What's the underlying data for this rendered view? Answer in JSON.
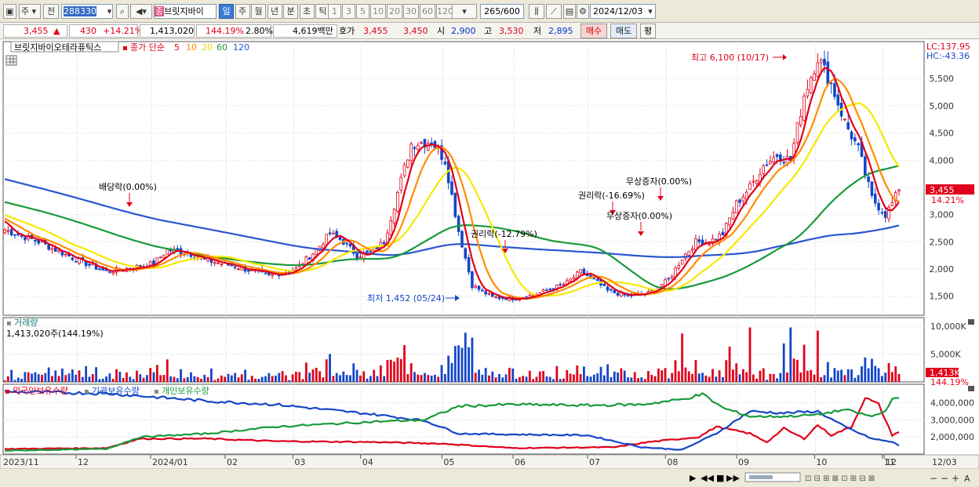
{
  "toolbar": {
    "market": "주",
    "prev": "전",
    "code": "288330",
    "badge": "종",
    "name": "브릿지바이",
    "periods": [
      "일",
      "주",
      "월",
      "년",
      "분",
      "초",
      "틱"
    ],
    "intervals": [
      "1",
      "3",
      "5",
      "10",
      "20",
      "30",
      "60",
      "120"
    ],
    "count": "265/600",
    "date": "2024/12/03"
  },
  "info": {
    "price": "3,455",
    "change": "430",
    "change_pct": "+14.21%",
    "volume": "1,413,020",
    "volume_ratio": "144.19%",
    "turnover": "2.80%",
    "amount": "4,619백만",
    "quote_label": "호가",
    "ask": "3,455",
    "bid": "3,450",
    "open_label": "시",
    "open": "2,900",
    "high_label": "고",
    "high": "3,530",
    "low_label": "저",
    "low": "2,895",
    "buy": "매수",
    "sell": "매도",
    "eval": "평"
  },
  "colors": {
    "up": "#e0001a",
    "down": "#1546c8",
    "ma5": "#e0001a",
    "ma10": "#ff8c00",
    "ma20": "#f7e800",
    "ma60": "#1a9a3c",
    "ma120": "#2a56d0"
  },
  "price_pane": {
    "stock_name": "브릿지바이오테라퓨틱스",
    "series_label": "종가 단순",
    "ma_labels": [
      "5",
      "10",
      "20",
      "60",
      "120"
    ],
    "lc": "LC:137.95",
    "hc": "HC:-43.36",
    "current_tag": "3,455",
    "current_pct": "14.21%",
    "annotations": {
      "dividend": "배당락(0.00%)",
      "rights1": "권리락(-12.79%)",
      "rights2": "권리락(-16.69%)",
      "bonus1": "무상증자(0.00%)",
      "bonus2": "무상증자(0.00%)",
      "max": "최고 6,100 (10/17)",
      "min": "최저 1,452 (05/24)"
    }
  },
  "volume_pane": {
    "title": "거래량",
    "value": "1,413,020주(144.19%)",
    "tag": "1,413K",
    "tag_pct": "144.19%"
  },
  "holdings_pane": {
    "legend": [
      "외국인보유수량",
      "기관보유수량",
      "개인보유수량"
    ]
  },
  "x_axis": [
    "2023/11",
    "12",
    "2024/01",
    "02",
    "03",
    "04",
    "05",
    "06",
    "07",
    "08",
    "09",
    "10",
    "11",
    "12",
    "12/03"
  ],
  "chart_data": [
    {
      "type": "line",
      "title": "브릿지바이오테라퓨틱스 종가 단순",
      "x": [
        "2023/11",
        "12",
        "2024/01",
        "02",
        "03",
        "04",
        "05",
        "06",
        "07",
        "08",
        "09",
        "10",
        "11",
        "12"
      ],
      "y_ticks": [
        1500,
        2000,
        2500,
        3000,
        3500,
        4000,
        4500,
        5000,
        5500
      ],
      "ylim": [
        1150,
        6180
      ],
      "series": [
        {
          "name": "5",
          "values": [
            2700,
            2000,
            2300,
            1800,
            2300,
            4300,
            1500,
            1950,
            1550,
            2600,
            4000,
            6000,
            3500,
            3450
          ]
        },
        {
          "name": "10",
          "values": [
            2700,
            2020,
            2250,
            1850,
            2200,
            4300,
            1550,
            1900,
            1600,
            2550,
            3900,
            5800,
            3700,
            3150
          ]
        },
        {
          "name": "20",
          "values": [
            2700,
            2050,
            2200,
            1900,
            2150,
            3500,
            1700,
            1750,
            1650,
            2400,
            3700,
            5000,
            4200,
            3100
          ]
        },
        {
          "name": "60",
          "values": [
            3650,
            2650,
            2400,
            2200,
            2200,
            2450,
            2750,
            2480,
            2250,
            1900,
            2550,
            3350,
            4050,
            4100
          ]
        },
        {
          "name": "120",
          "values": [
            4200,
            3450,
            3200,
            2800,
            2600,
            2450,
            2350,
            2300,
            2250,
            2250,
            2450,
            2650,
            3000,
            3150
          ]
        }
      ]
    },
    {
      "type": "bar",
      "title": "거래량",
      "y_ticks": [
        "5,000K",
        "10,000K"
      ],
      "categories": [
        "2023/11",
        "12",
        "2024/01",
        "02",
        "03",
        "04",
        "05",
        "06",
        "07",
        "08",
        "09",
        "10",
        "11",
        "12"
      ],
      "values": [
        300,
        900,
        1200,
        500,
        800,
        5800,
        3500,
        1800,
        900,
        6500,
        6800,
        4200,
        2500,
        1413
      ]
    },
    {
      "type": "line",
      "title": "보유수량",
      "y_ticks": [
        "2,000,000",
        "3,000,000",
        "4,000,000"
      ],
      "x": [
        "2023/11",
        "12",
        "2024/01",
        "02",
        "03",
        "04",
        "05",
        "06",
        "07",
        "08",
        "09",
        "10",
        "11",
        "12"
      ],
      "series": [
        {
          "name": "외국인보유수량",
          "values": [
            1300000,
            1400000,
            1900000,
            1700000,
            1700000,
            1500000,
            1400000,
            1300000,
            1500000,
            2100000,
            2000000,
            2500000,
            4300000,
            2300000
          ]
        },
        {
          "name": "기관보유수량",
          "values": [
            4700000,
            4600000,
            4300000,
            3800000,
            3500000,
            3000000,
            2100000,
            2000000,
            2000000,
            1200000,
            2100000,
            3500000,
            2500000,
            1700000
          ]
        },
        {
          "name": "개인보유수량",
          "values": [
            1200000,
            1300000,
            2000000,
            2200000,
            2700000,
            3000000,
            3800000,
            3800000,
            3800000,
            4000000,
            3700000,
            3200000,
            3100000,
            4300000
          ]
        }
      ]
    }
  ]
}
